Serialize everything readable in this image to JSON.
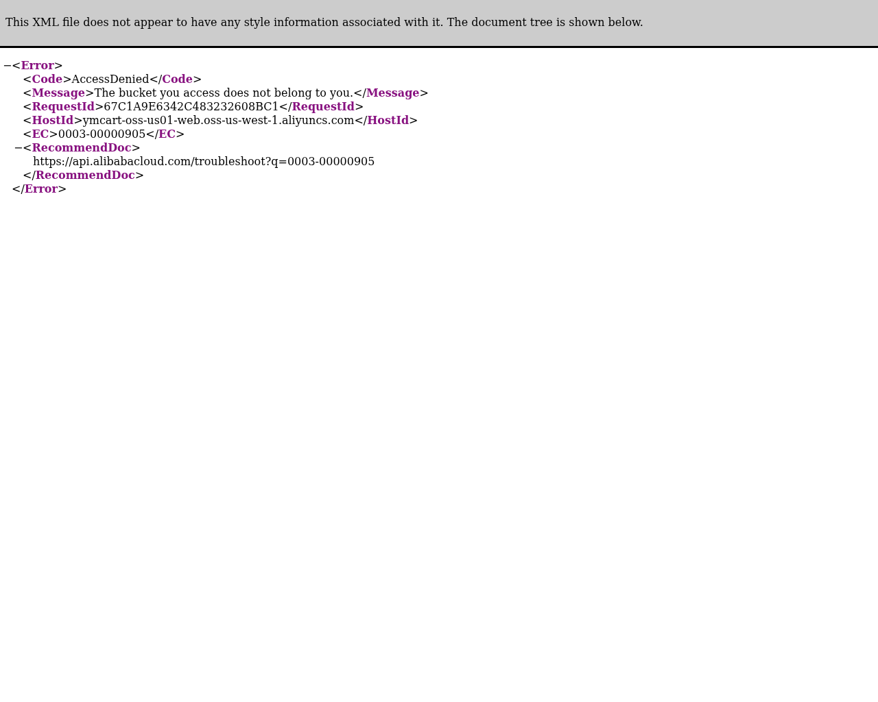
{
  "info_banner": {
    "text": "This XML file does not appear to have any style information associated with it. The document tree is shown below."
  },
  "tree": {
    "toggle": "−",
    "open": [
      {
        "kind": "punct",
        "text": "<"
      },
      {
        "kind": "tag",
        "text": "Error"
      },
      {
        "kind": "punct",
        "text": ">"
      }
    ],
    "children": [
      {
        "open": [
          {
            "kind": "punct",
            "text": "<"
          },
          {
            "kind": "tag",
            "text": "Code"
          },
          {
            "kind": "punct",
            "text": ">"
          }
        ],
        "text": "AccessDenied",
        "close": [
          {
            "kind": "punct",
            "text": "</"
          },
          {
            "kind": "tag",
            "text": "Code"
          },
          {
            "kind": "punct",
            "text": ">"
          }
        ]
      },
      {
        "open": [
          {
            "kind": "punct",
            "text": "<"
          },
          {
            "kind": "tag",
            "text": "Message"
          },
          {
            "kind": "punct",
            "text": ">"
          }
        ],
        "text": "The bucket you access does not belong to you.",
        "close": [
          {
            "kind": "punct",
            "text": "</"
          },
          {
            "kind": "tag",
            "text": "Message"
          },
          {
            "kind": "punct",
            "text": ">"
          }
        ]
      },
      {
        "open": [
          {
            "kind": "punct",
            "text": "<"
          },
          {
            "kind": "tag",
            "text": "RequestId"
          },
          {
            "kind": "punct",
            "text": ">"
          }
        ],
        "text": "67C1A9E6342C483232608BC1",
        "close": [
          {
            "kind": "punct",
            "text": "</"
          },
          {
            "kind": "tag",
            "text": "RequestId"
          },
          {
            "kind": "punct",
            "text": ">"
          }
        ]
      },
      {
        "open": [
          {
            "kind": "punct",
            "text": "<"
          },
          {
            "kind": "tag",
            "text": "HostId"
          },
          {
            "kind": "punct",
            "text": ">"
          }
        ],
        "text": "ymcart-oss-us01-web.oss-us-west-1.aliyuncs.com",
        "close": [
          {
            "kind": "punct",
            "text": "</"
          },
          {
            "kind": "tag",
            "text": "HostId"
          },
          {
            "kind": "punct",
            "text": ">"
          }
        ]
      },
      {
        "open": [
          {
            "kind": "punct",
            "text": "<"
          },
          {
            "kind": "tag",
            "text": "EC"
          },
          {
            "kind": "punct",
            "text": ">"
          }
        ],
        "text": "0003-00000905",
        "close": [
          {
            "kind": "punct",
            "text": "</"
          },
          {
            "kind": "tag",
            "text": "EC"
          },
          {
            "kind": "punct",
            "text": ">"
          }
        ]
      },
      {
        "toggle": "−",
        "open": [
          {
            "kind": "punct",
            "text": "<"
          },
          {
            "kind": "tag",
            "text": "RecommendDoc"
          },
          {
            "kind": "punct",
            "text": ">"
          }
        ],
        "content": "https://api.alibabacloud.com/troubleshoot?q=0003-00000905",
        "close": [
          {
            "kind": "punct",
            "text": "</"
          },
          {
            "kind": "tag",
            "text": "RecommendDoc"
          },
          {
            "kind": "punct",
            "text": ">"
          }
        ]
      }
    ],
    "close": [
      {
        "kind": "punct",
        "text": "</"
      },
      {
        "kind": "tag",
        "text": "Error"
      },
      {
        "kind": "punct",
        "text": ">"
      }
    ]
  }
}
